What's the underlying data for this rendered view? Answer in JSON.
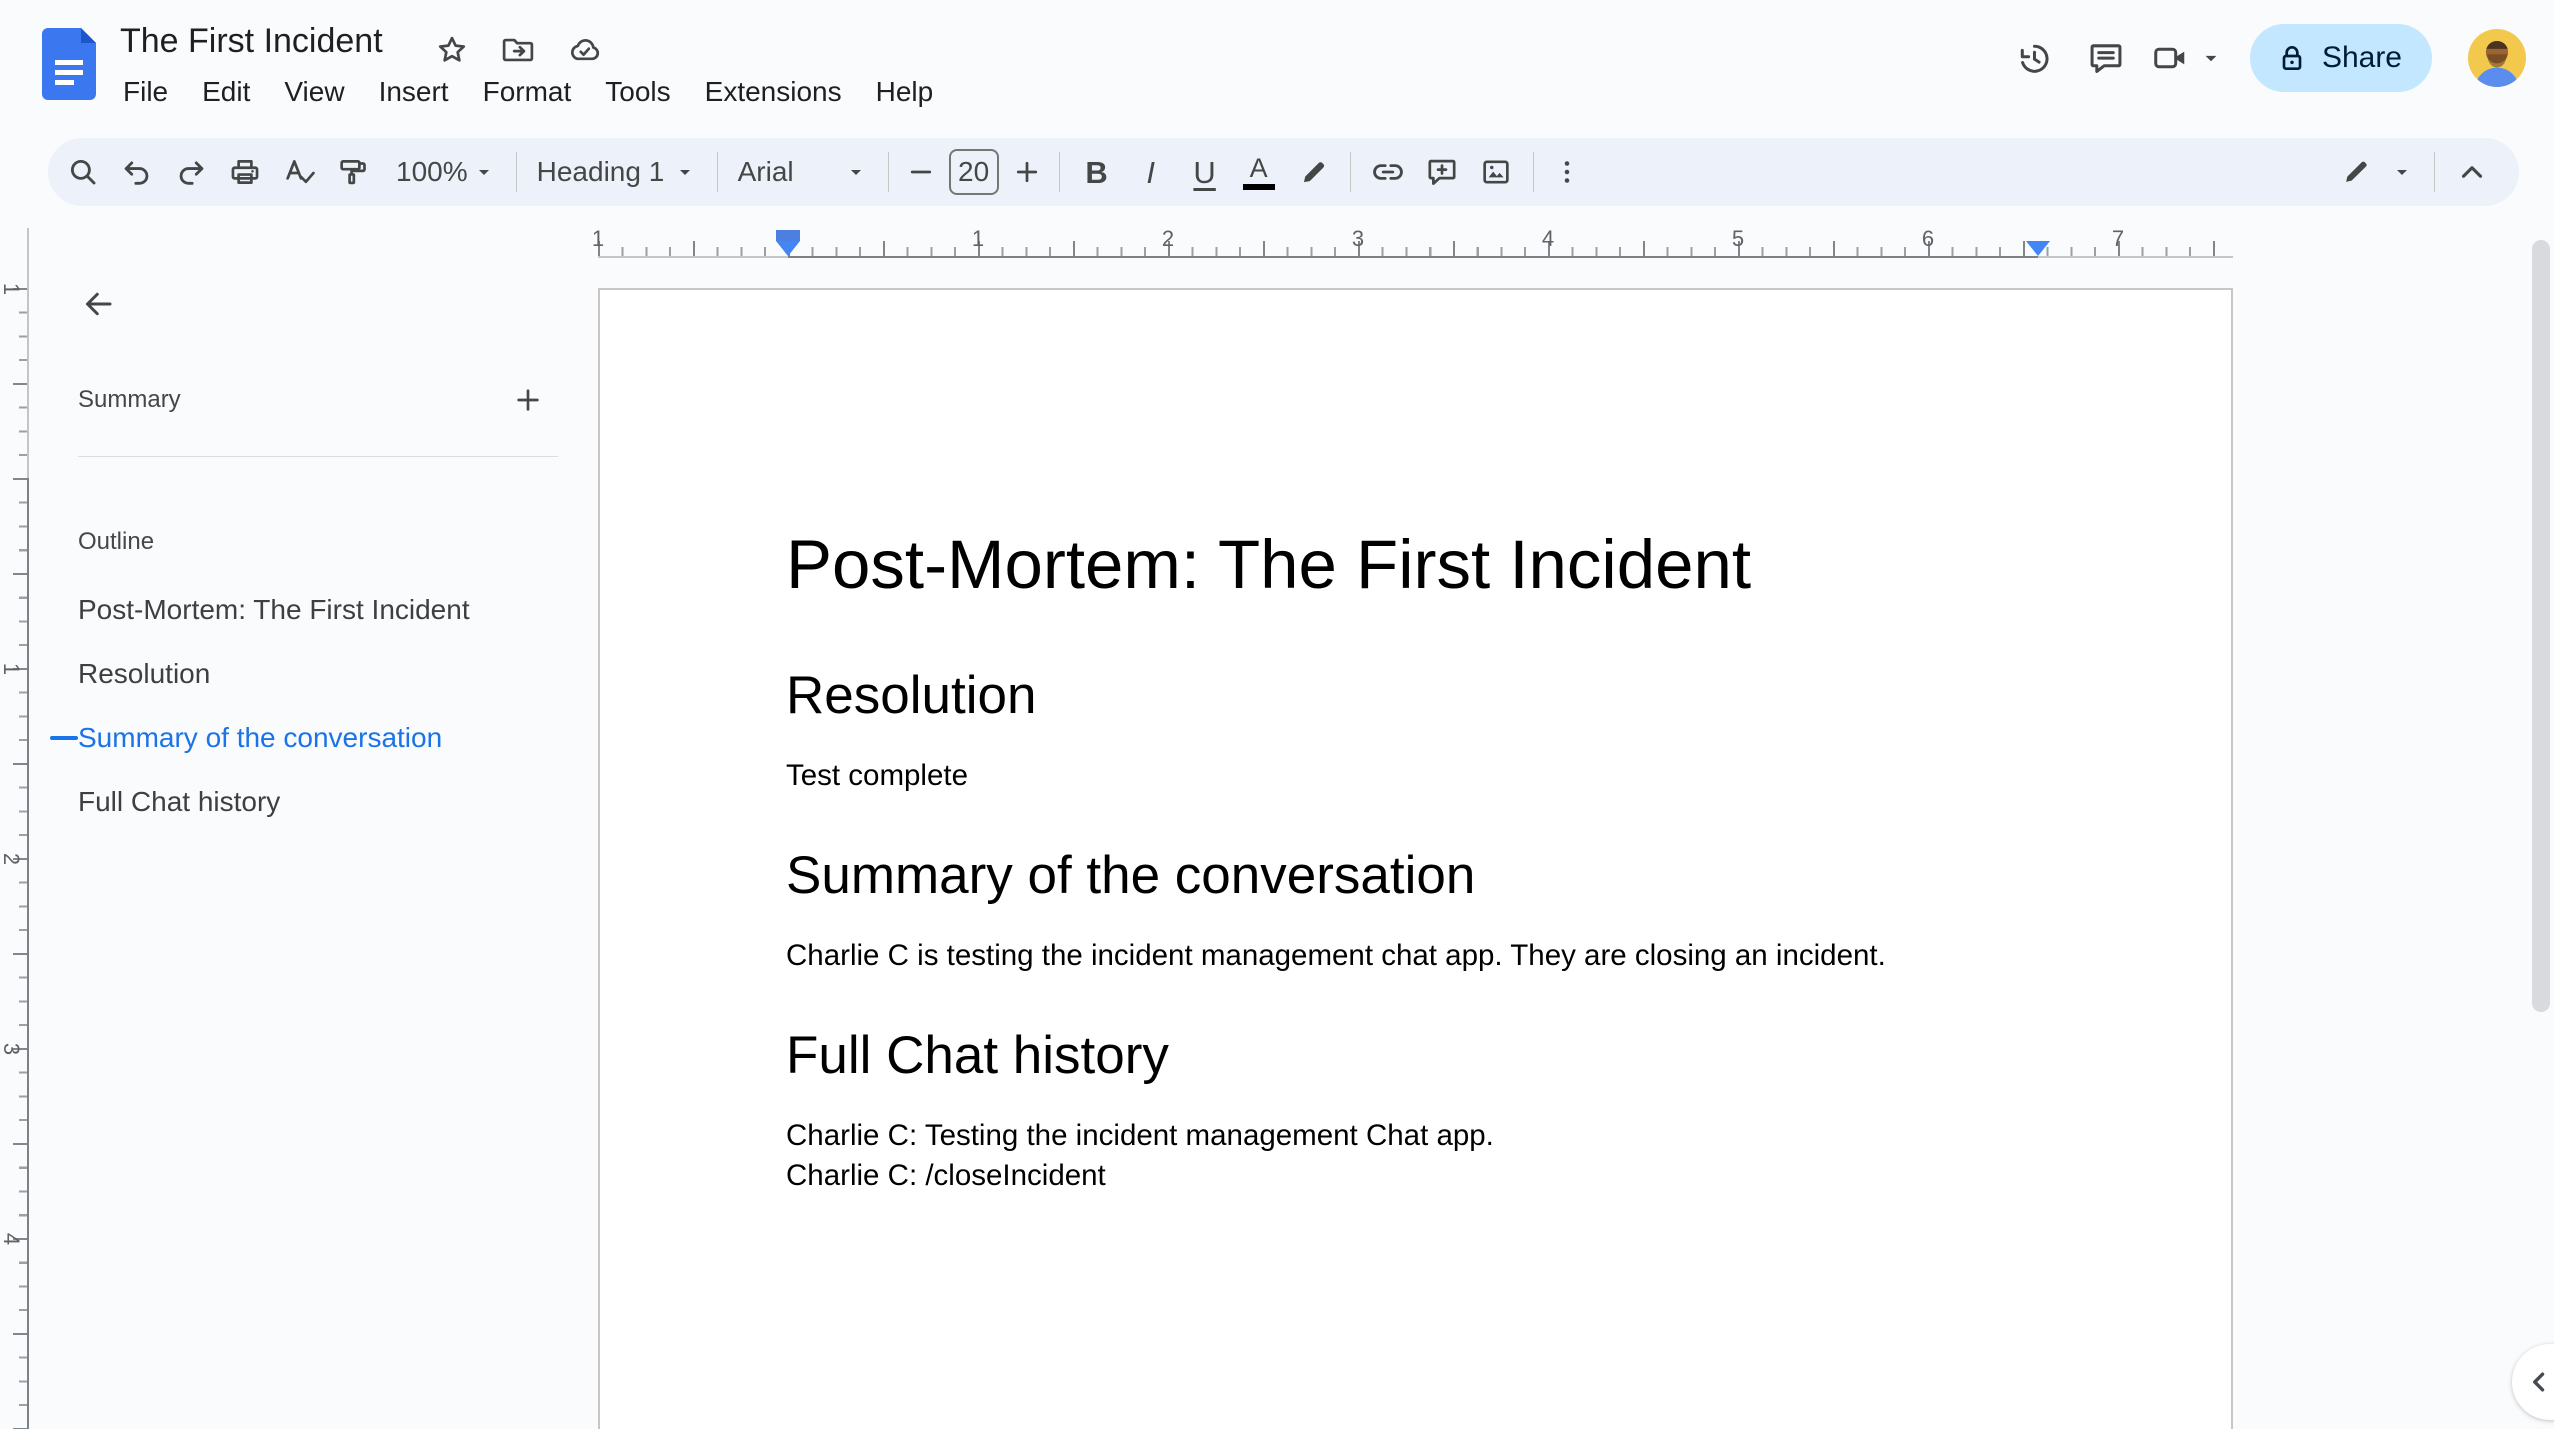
{
  "header": {
    "doc_title": "The First Incident",
    "menus": [
      "File",
      "Edit",
      "View",
      "Insert",
      "Format",
      "Tools",
      "Extensions",
      "Help"
    ],
    "share_label": "Share"
  },
  "toolbar": {
    "zoom_value": "100%",
    "style_value": "Heading 1",
    "font_value": "Arial",
    "font_size": "20",
    "bold_label": "B",
    "italic_label": "I",
    "underline_label": "U",
    "text_color_label": "A"
  },
  "sidebar": {
    "summary_label": "Summary",
    "outline_label": "Outline",
    "outline_items": [
      {
        "label": "Post-Mortem: The First Incident",
        "active": false
      },
      {
        "label": "Resolution",
        "active": false
      },
      {
        "label": "Summary of the conversation",
        "active": true
      },
      {
        "label": "Full Chat history",
        "active": false
      }
    ]
  },
  "ruler": {
    "h_labels": [
      "1",
      "1",
      "2",
      "3",
      "4",
      "5",
      "6",
      "7"
    ],
    "v_labels": [
      "1",
      "1",
      "2",
      "3",
      "4"
    ]
  },
  "document": {
    "title": "Post-Mortem: The First Incident",
    "sections": [
      {
        "heading": "Resolution",
        "paragraphs": [
          "Test complete"
        ]
      },
      {
        "heading": "Summary of the conversation",
        "paragraphs": [
          "Charlie C is testing the incident management chat app. They are closing an incident."
        ]
      },
      {
        "heading": "Full Chat history",
        "paragraphs": [
          "Charlie C: Testing the incident management Chat app.",
          "Charlie C: /closeIncident"
        ]
      }
    ]
  },
  "colors": {
    "toolbar_bg": "#edf2fa",
    "share_bg": "#c2e7ff",
    "share_text": "#001d35",
    "outline_active": "#1a73e8",
    "ruler_marker_blue": "#4285f4",
    "logo_blue": "#3b78ef",
    "icon_gray": "#444746",
    "page_border": "#c7c7c5",
    "canvas_bg": "#f9fbfd"
  },
  "icons": {
    "docs-logo": "blue page with white lines",
    "star-icon": "outline star",
    "move-folder-icon": "folder with right arrow",
    "cloud-status-icon": "cloud with checkmark",
    "version-history-icon": "clock with ccw arrow",
    "comments-icon": "speech bubble with lines",
    "video-call-icon": "camera with lens triangle",
    "lock-icon": "padlock",
    "search-icon": "magnifier",
    "undo-icon": "curved arrow left",
    "redo-icon": "curved arrow right",
    "print-icon": "printer",
    "spellcheck-icon": "A with checkmark",
    "paint-format-icon": "paint roller",
    "highlight-icon": "marker pen",
    "insert-link-icon": "chain link",
    "add-comment-icon": "bubble with plus",
    "insert-image-icon": "picture with mountains",
    "more-icon": "vertical kebab dots",
    "editing-mode-icon": "pencil",
    "hide-menus-icon": "chevron up",
    "back-icon": "arrow left",
    "plus-icon": "plus",
    "collapse-panel-icon": "chevron left"
  }
}
